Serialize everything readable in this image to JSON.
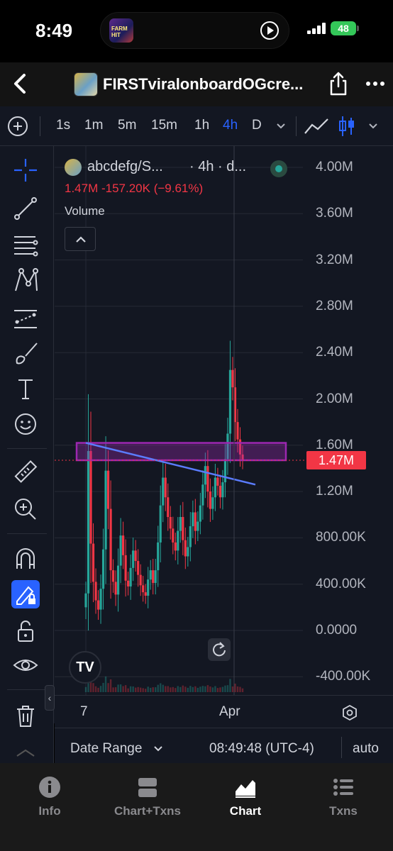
{
  "status_bar": {
    "time": "8:49",
    "battery": "48",
    "island_text": "FARM HIT"
  },
  "nav": {
    "title": "FIRSTviralonboardOGcre..."
  },
  "intervals": {
    "items": [
      "1s",
      "1m",
      "5m",
      "15m",
      "1h",
      "4h",
      "D"
    ],
    "active": "4h"
  },
  "legend": {
    "symbol": "abcdefg/S...",
    "interval": "· 4h · d...",
    "values": "1.47M  -157.20K (−9.61%)",
    "volume_label": "Volume"
  },
  "price_axis": {
    "ticks": [
      "4.00M",
      "3.60M",
      "3.20M",
      "2.80M",
      "2.40M",
      "2.00M",
      "1.60M",
      "1.20M",
      "800.00K",
      "400.00K",
      "0.0000",
      "-400.00K"
    ],
    "current_price_label": "1.47M"
  },
  "time_axis": {
    "ticks": [
      "7",
      "Apr"
    ]
  },
  "footer": {
    "date_range": "Date Range",
    "clock": "08:49:48 (UTC-4)",
    "scale_mode": "auto"
  },
  "tabs": [
    {
      "label": "Info",
      "icon": "info-icon"
    },
    {
      "label": "Chart+Txns",
      "icon": "split-view-icon"
    },
    {
      "label": "Chart",
      "icon": "area-chart-icon",
      "active": true
    },
    {
      "label": "Txns",
      "icon": "list-icon"
    }
  ],
  "colors": {
    "up": "#26a69a",
    "down": "#f23645",
    "accent": "#2962ff",
    "zone": "#9c27b0",
    "trendline": "#5b7cff"
  },
  "chart_data": {
    "type": "candlestick",
    "interval": "4h",
    "ylim": [
      -400000,
      4000000
    ],
    "current_price": 1470000,
    "change": -157200,
    "change_pct": -9.61,
    "close_series": [
      320000,
      1550000,
      750000,
      420000,
      260000,
      180000,
      360000,
      700000,
      1380000,
      1050000,
      520000,
      420000,
      310000,
      560000,
      820000,
      650000,
      430000,
      380000,
      540000,
      690000,
      600000,
      480000,
      390000,
      330000,
      300000,
      440000,
      520000,
      410000,
      520000,
      760000,
      1080000,
      1320000,
      1150000,
      980000,
      880000,
      760000,
      690000,
      860000,
      980000,
      780000,
      640000,
      720000,
      900000,
      1020000,
      860000,
      940000,
      1080000,
      1260000,
      1420000,
      1200000,
      1050000,
      1150000,
      1320000,
      1250000,
      1150000,
      1280000,
      1480000,
      1700000,
      2250000,
      2100000,
      1800000,
      1650000,
      1520000,
      1470000
    ],
    "annotations": [
      {
        "type": "rectangle",
        "label": "resistance zone",
        "y_range": [
          1470000,
          1620000
        ]
      },
      {
        "type": "trendline",
        "from_value": 1620000,
        "to_value": 1260000
      }
    ]
  }
}
